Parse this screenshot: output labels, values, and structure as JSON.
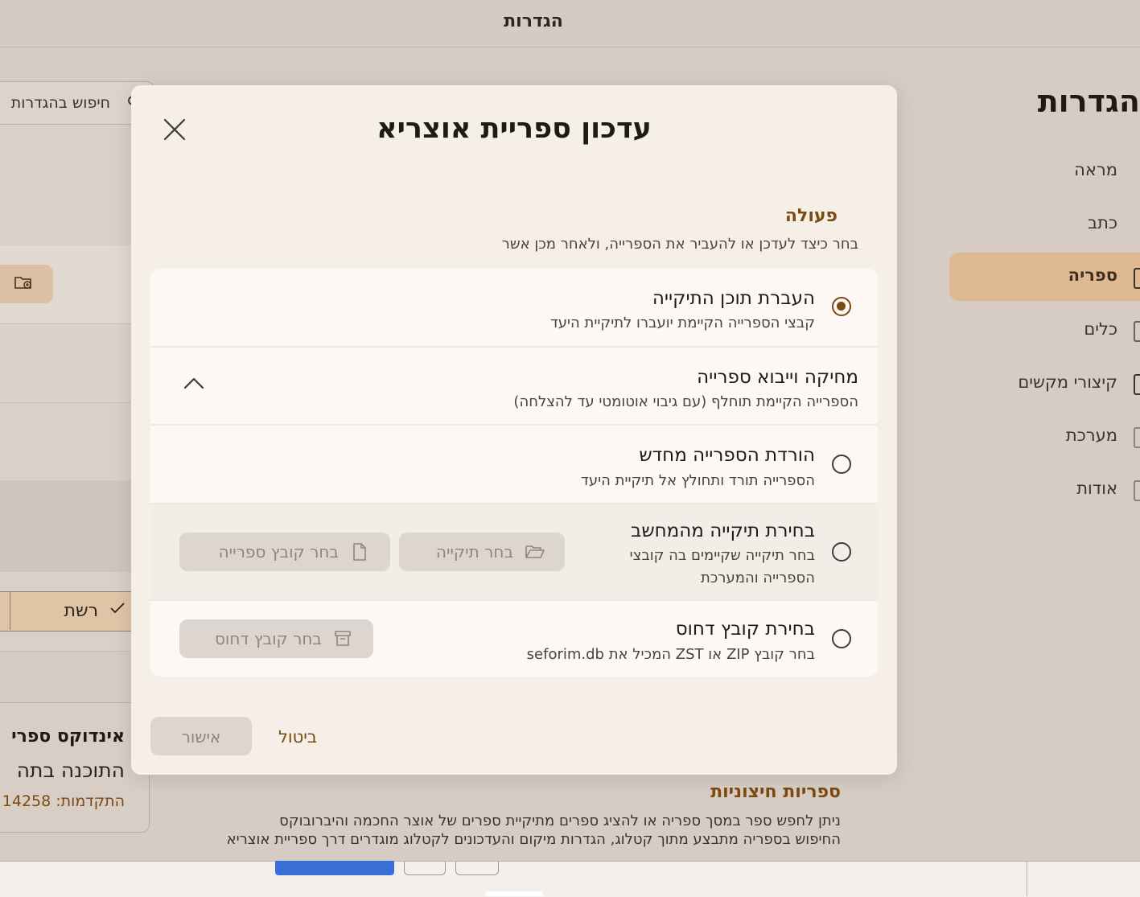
{
  "app": {
    "title": "הגדרות"
  },
  "settings_nav": {
    "heading": "הגדרות",
    "items": [
      {
        "label": "מראה"
      },
      {
        "label": "כתב"
      },
      {
        "label": "ספריה",
        "active": true
      },
      {
        "label": "כלים"
      },
      {
        "label": "קיצורי מקשים"
      },
      {
        "label": "מערכת"
      },
      {
        "label": "אודות"
      }
    ]
  },
  "background": {
    "search_placeholder": "חיפוש בהגדרות",
    "network_label": "רשת",
    "index_title": "אינדוקס ספרי",
    "index_sub": "התוכנה בתה",
    "index_progress": "התקדמות: 14258",
    "external_title": "ספריות חיצוניות",
    "external_line1": "ניתן לחפש ספר במסך ספריה או להציג ספרים מתיקיית ספרים של אוצר החכמה והיברובוקס",
    "external_line2": "החיפוש בספריה מתבצע מתוך קטלוג, הגדרות מיקום והעדכונים לקטלוג מוגדרים דרך ספריית אוצריא"
  },
  "dialog": {
    "title": "עדכון ספריית אוצריא",
    "section_title": "פעולה",
    "section_subtitle": "בחר כיצד לעדכן או להעביר את הספרייה, ולאחר מכן אשר",
    "options": [
      {
        "title": "העברת תוכן התיקייה",
        "desc": "קבצי הספרייה הקיימת יועברו לתיקיית היעד",
        "selected": true
      },
      {
        "title": "מחיקה וייבוא ספרייה",
        "desc": "הספרייה הקיימת תוחלף (עם גיבוי אוטומטי עד להצלחה)"
      },
      {
        "title": "הורדת הספרייה מחדש",
        "desc": "הספרייה תורד ותחולץ אל תיקיית היעד"
      },
      {
        "title": "בחירת תיקייה מהמחשב",
        "desc_line1": "בחר תיקייה שקיימים בה קובצי",
        "desc_line2": "הספרייה והמערכת",
        "buttons": {
          "folder": "בחר תיקייה",
          "file": "בחר קובץ ספרייה"
        }
      },
      {
        "title": "בחירת קובץ דחוס",
        "desc": "בחר קובץ ZIP או ZST המכיל את seforim.db",
        "buttons": {
          "archive": "בחר קובץ דחוס"
        }
      }
    ],
    "cancel_label": "ביטול",
    "confirm_label": "אישור"
  },
  "colors": {
    "accent": "#7a4a10",
    "active_nav": "#deb992",
    "dialog_bg": "#f6efe8",
    "disabled_btn": "#ddd5cf"
  },
  "icons": {
    "close": "close-icon",
    "chevron": "chevron-up-icon",
    "folder": "folder-open-icon",
    "file": "file-icon",
    "archive": "archive-icon",
    "search": "search-icon"
  }
}
